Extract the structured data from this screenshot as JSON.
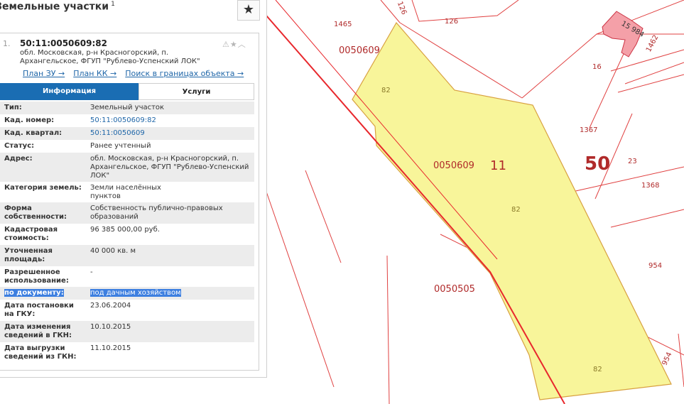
{
  "panel": {
    "title": "Земельные участки",
    "title_count": "1",
    "card": {
      "index": "1.",
      "cad_number": "50:11:0050609:82",
      "address": "обл. Московская, р-н Красногорский, п. Архангельское, ФГУП \"Рублево-Успенский ЛОК\"",
      "links": [
        "План ЗУ →",
        "План КК →",
        "Поиск в границах объекта →"
      ],
      "tabs": [
        "Информация",
        "Услуги"
      ],
      "rows": [
        {
          "label": "Тип:",
          "value": "Земельный участок"
        },
        {
          "label": "Кад. номер:",
          "value": "50:11:0050609:82"
        },
        {
          "label": "Кад. квартал:",
          "value": "50:11:0050609"
        },
        {
          "label": "Статус:",
          "value": "Ранее учтенный"
        },
        {
          "label": "Адрес:",
          "value": "обл. Московская, р-н Красногорский, п. Архангельское, ФГУП \"Рублево-Успенский ЛОК\""
        },
        {
          "label": "Категория земель:",
          "value": "Земли населённых пунктов"
        },
        {
          "label": "Форма собственности:",
          "value": "Собственность публично-правовых образований"
        },
        {
          "label": "Кадастровая стоимость:",
          "value": "96 385 000,00 руб."
        },
        {
          "label": "Уточненная площадь:",
          "value": "40 000 кв. м"
        },
        {
          "label": "Разрешенное использование:",
          "value": "-"
        },
        {
          "label": "по документу:",
          "value": "под дачным хозяйством"
        },
        {
          "label": "Дата постановки на ГКУ:",
          "value": "23.06.2004"
        },
        {
          "label": "Дата изменения сведений в ГКН:",
          "value": "10.10.2015"
        },
        {
          "label": "Дата выгрузки сведений из ГКН:",
          "value": "11.10.2015"
        }
      ]
    }
  },
  "map": {
    "labels": {
      "n126a": "126",
      "n1465": "1465",
      "n126b": "126",
      "n15984": "15 984",
      "n1462": "1462",
      "n16": "16",
      "q0050609a": "0050609",
      "n82a": "82",
      "q0050609b": "0050609",
      "r11": "11",
      "r50": "50",
      "n1367": "1367",
      "n23": "23",
      "n1368": "1368",
      "n82b": "82",
      "n954a": "954",
      "q0050505": "0050505",
      "n954b": "954",
      "n82c": "82"
    }
  },
  "colors": {
    "parcel_fill": "#f8f59a",
    "parcel_stroke": "#d8a040",
    "boundary": "#e8282d",
    "building": "#f4a0a8",
    "accent": "#1a6db3"
  }
}
